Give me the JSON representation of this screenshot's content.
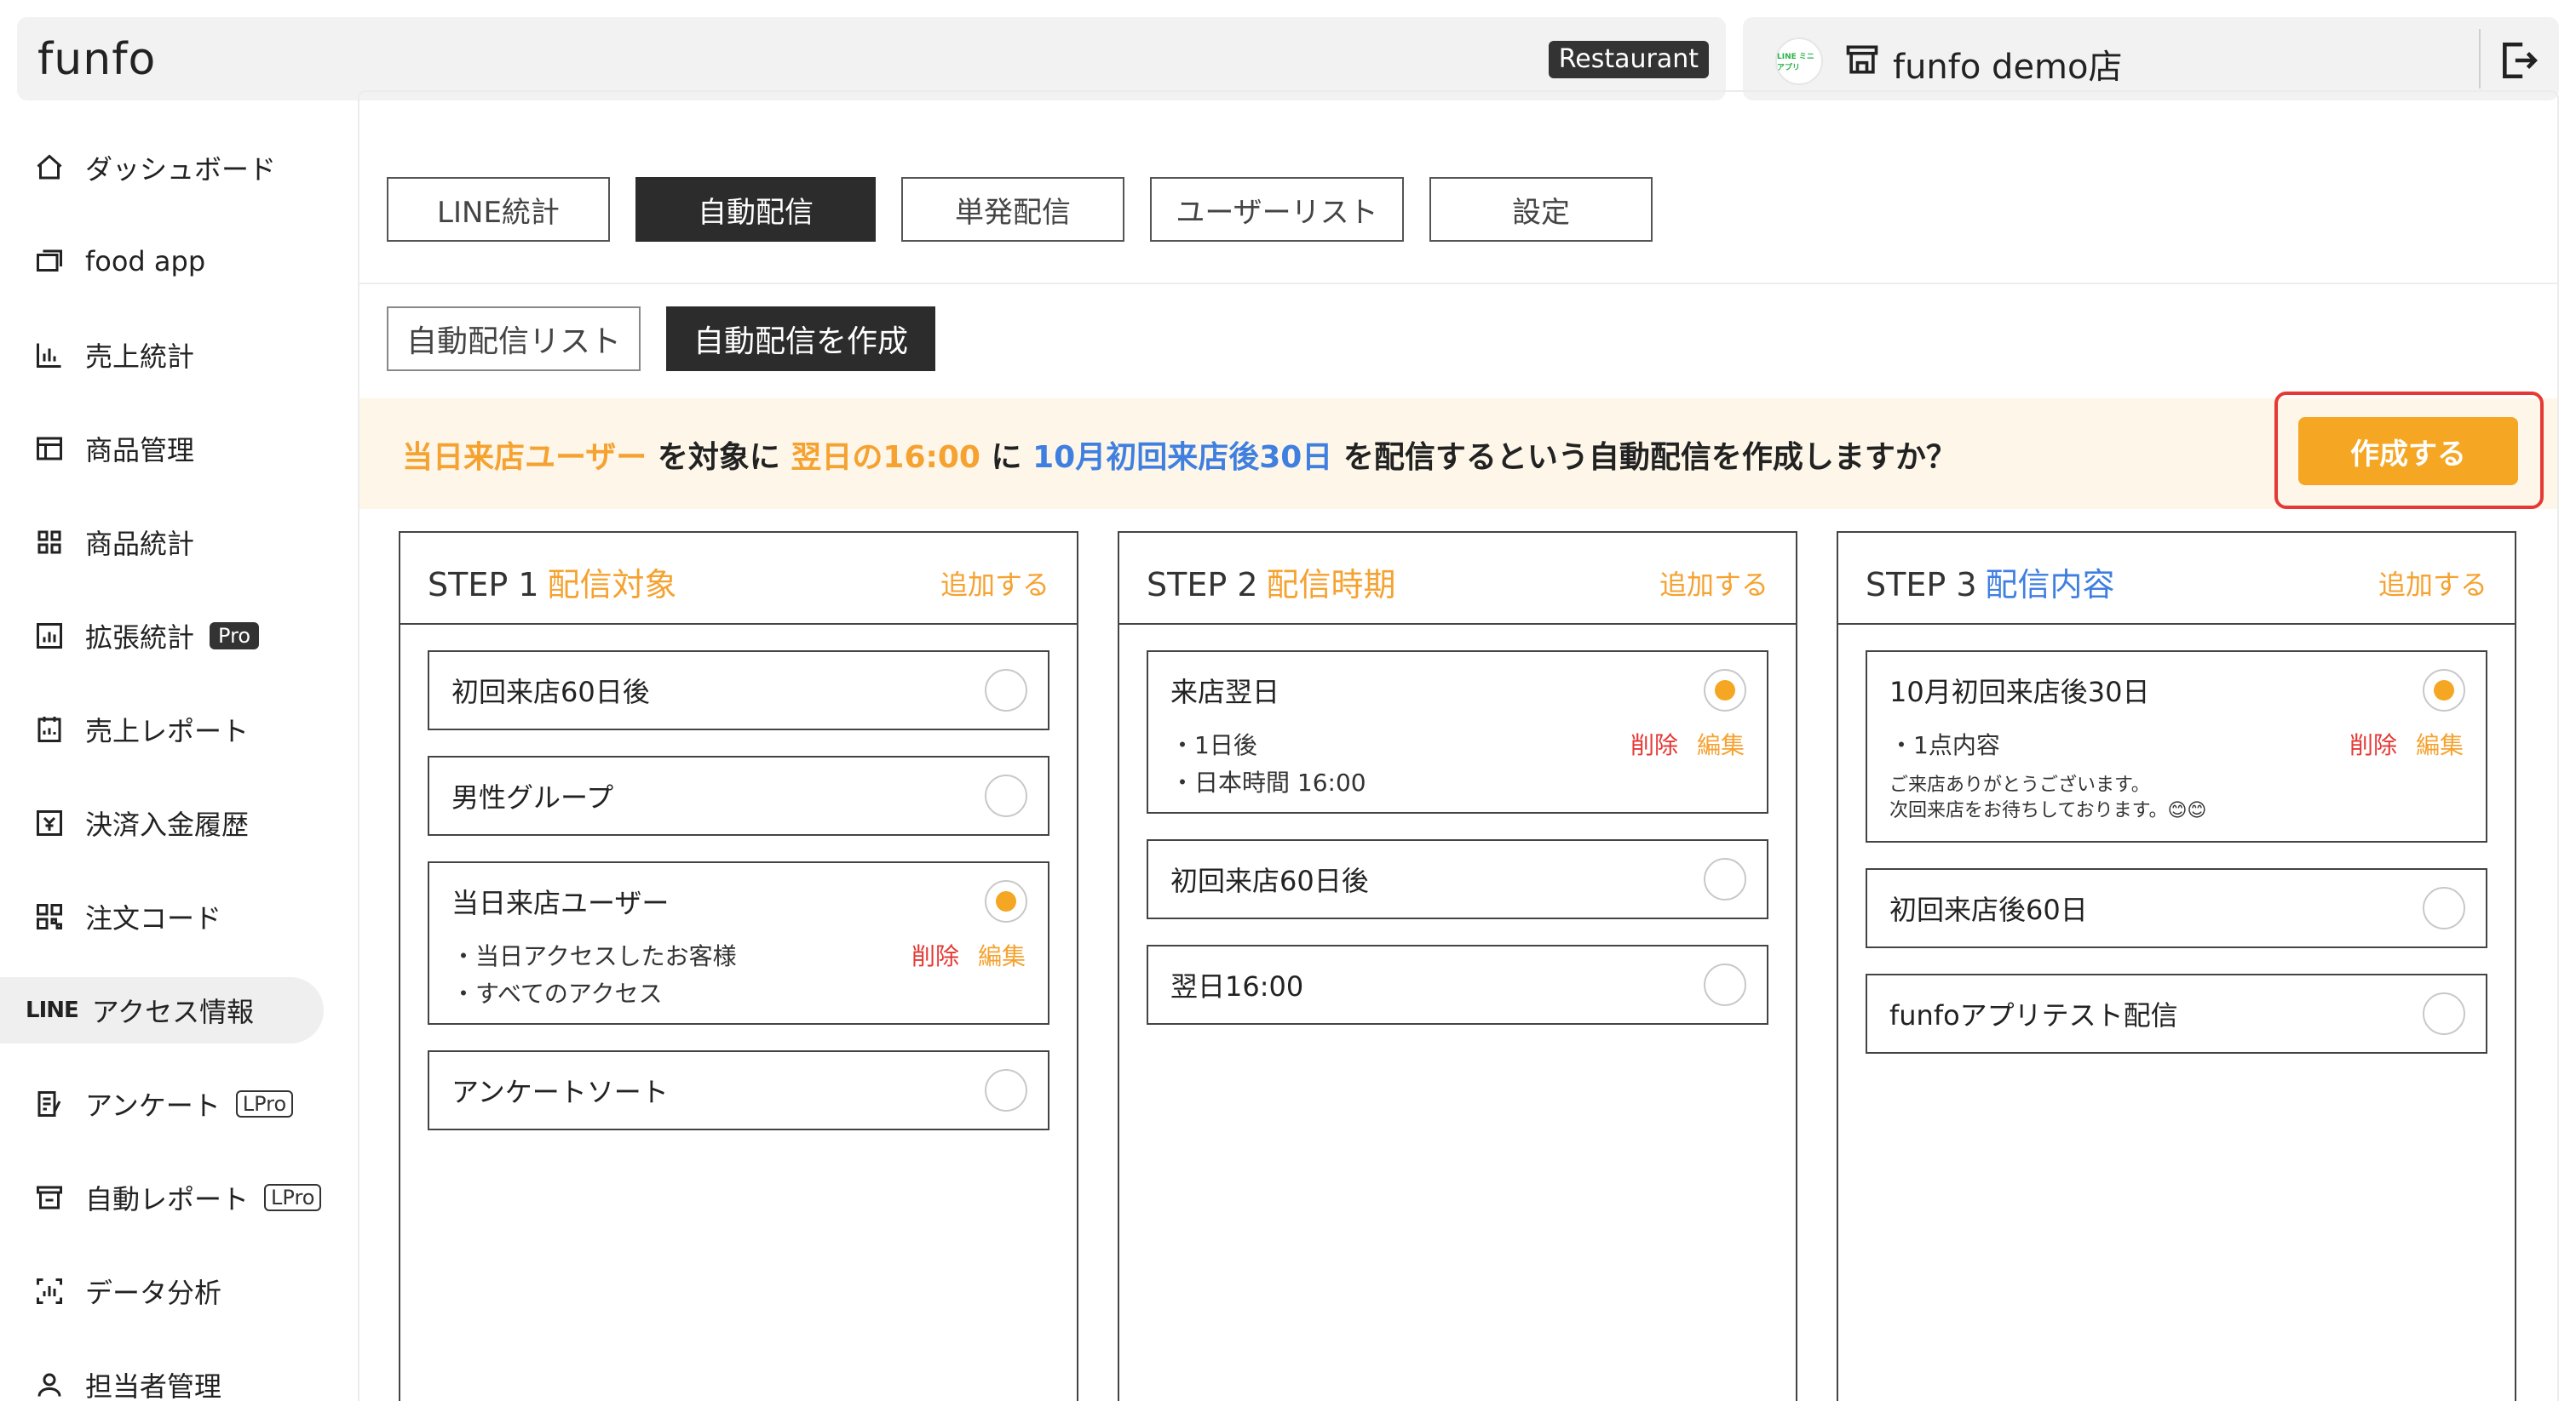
{
  "header": {
    "logo": "funfo",
    "badge": "Restaurant",
    "store_logo_text": "LINE ミニアプリ",
    "store_name": "funfo demo店"
  },
  "sidebar": {
    "items": [
      {
        "label": "ダッシュボード",
        "icon": "home-icon"
      },
      {
        "label": "food app",
        "icon": "app-icon"
      },
      {
        "label": "売上統計",
        "icon": "bar-chart-icon"
      },
      {
        "label": "商品管理",
        "icon": "table-icon"
      },
      {
        "label": "商品統計",
        "icon": "grid-icon"
      },
      {
        "label": "拡張統計",
        "icon": "chart-box-icon",
        "badge": "Pro"
      },
      {
        "label": "売上レポート",
        "icon": "report-icon"
      },
      {
        "label": "決済入金履歴",
        "icon": "payment-icon"
      },
      {
        "label": "注文コード",
        "icon": "qr-icon"
      },
      {
        "label": "アクセス情報",
        "prefix": "LINE"
      },
      {
        "label": "アンケート",
        "icon": "survey-icon",
        "badge": "LPro"
      },
      {
        "label": "自動レポート",
        "icon": "auto-report-icon",
        "badge": "LPro"
      },
      {
        "label": "データ分析",
        "icon": "analysis-icon"
      },
      {
        "label": "担当者管理",
        "icon": "user-icon"
      }
    ]
  },
  "tabs": [
    "LINE統計",
    "自動配信",
    "単発配信",
    "ユーザーリスト",
    "設定"
  ],
  "subtabs": [
    "自動配信リスト",
    "自動配信を作成"
  ],
  "confirm": {
    "target": "当日来店ユーザー",
    "t1": "を対象に",
    "timing": "翌日の16:00",
    "t2": "に",
    "content": "10月初回来店後30日",
    "t3": "を配信するという自動配信を作成しますか？",
    "create_label": "作成する"
  },
  "steps": [
    {
      "step": "STEP 1",
      "name": "配信対象",
      "add": "追加する",
      "cards": [
        {
          "title": "初回来店60日後",
          "selected": false
        },
        {
          "title": "男性グループ",
          "selected": false
        },
        {
          "title": "当日来店ユーザー",
          "selected": true,
          "lines": [
            "・当日アクセスしたお客様",
            "・すべてのアクセス"
          ],
          "delete": "削除",
          "edit": "編集"
        },
        {
          "title": "アンケートソート",
          "selected": false
        }
      ]
    },
    {
      "step": "STEP 2",
      "name": "配信時期",
      "add": "追加する",
      "cards": [
        {
          "title": "来店翌日",
          "selected": true,
          "lines": [
            "・1日後",
            "・日本時間 16:00"
          ],
          "delete": "削除",
          "edit": "編集"
        },
        {
          "title": "初回来店60日後",
          "selected": false
        },
        {
          "title": "翌日16:00",
          "selected": false
        }
      ]
    },
    {
      "step": "STEP 3",
      "name": "配信内容",
      "add": "追加する",
      "cards": [
        {
          "title": "10月初回来店後30日",
          "selected": true,
          "lines": [
            "・1点内容"
          ],
          "notes": [
            "ご来店ありがとうございます。",
            "次回来店をお待ちしております。😊😊"
          ],
          "delete": "削除",
          "edit": "編集"
        },
        {
          "title": "初回来店後60日",
          "selected": false
        },
        {
          "title": "funfoアプリテスト配信",
          "selected": false
        }
      ]
    }
  ],
  "colors": {
    "accent": "#f5a623",
    "blue": "#3f7fe0",
    "danger": "#e53935",
    "dark": "#2c2c2c"
  }
}
